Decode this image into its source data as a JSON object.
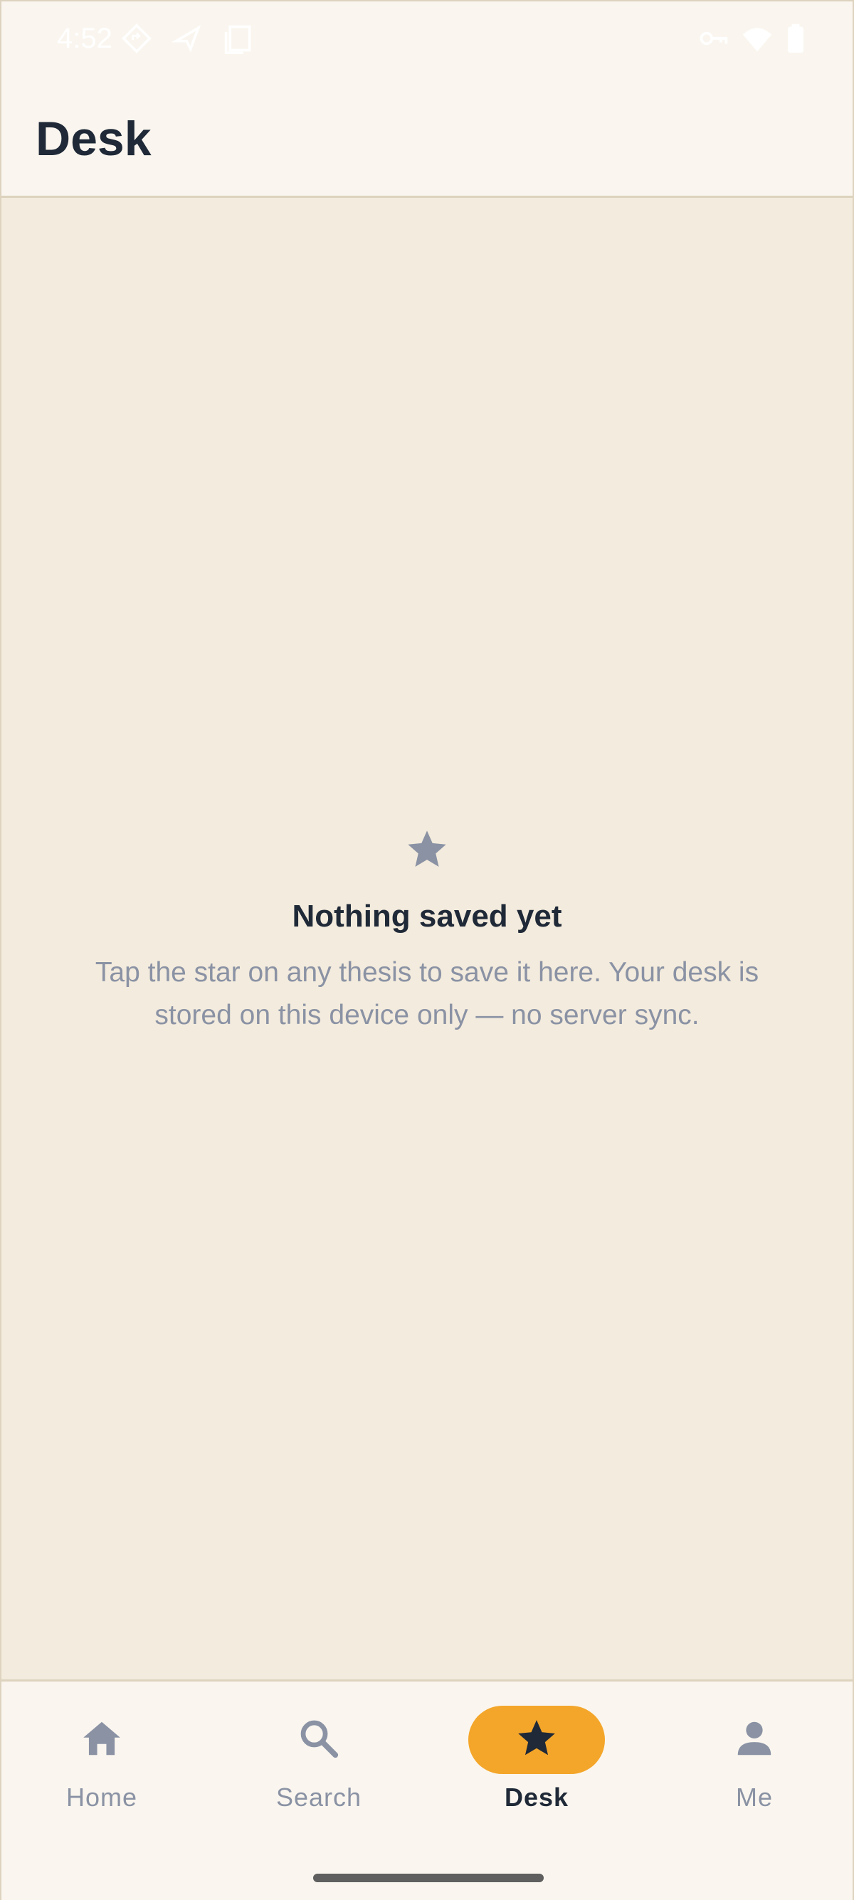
{
  "status_bar": {
    "time": "4:52",
    "left_icons": [
      "location-diamond-icon",
      "flight-icon",
      "screen-icon"
    ],
    "right_icons": [
      "vpn-key-icon",
      "wifi-icon",
      "battery-icon"
    ]
  },
  "app_bar": {
    "title": "Desk"
  },
  "empty_state": {
    "icon": "star-icon",
    "title": "Nothing saved yet",
    "message": "Tap the star on any thesis to save it here. Your desk is stored on this device only — no server sync."
  },
  "bottom_nav": {
    "items": [
      {
        "label": "Home",
        "icon": "home-icon",
        "active": false
      },
      {
        "label": "Search",
        "icon": "search-icon",
        "active": false
      },
      {
        "label": "Desk",
        "icon": "star-icon",
        "active": true
      },
      {
        "label": "Me",
        "icon": "person-icon",
        "active": false
      }
    ]
  },
  "colors": {
    "background": "#F3EBDD",
    "surface": "#FAF6EF",
    "border": "#DDD3BE",
    "accent": "#F4A62A",
    "text_primary": "#1F2937",
    "text_muted": "#8A92A4"
  }
}
